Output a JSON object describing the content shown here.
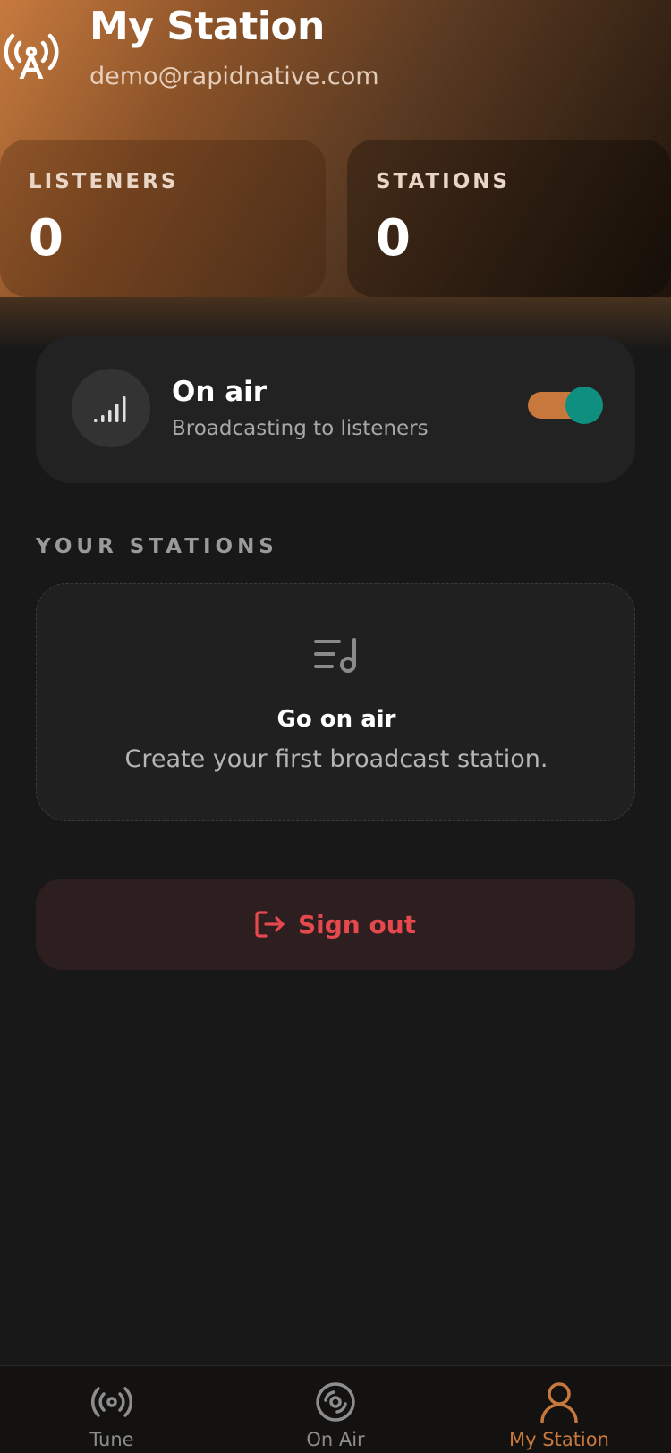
{
  "header": {
    "title": "My Station",
    "email": "demo@rapidnative.com"
  },
  "stats": [
    {
      "label": "LISTENERS",
      "value": "0"
    },
    {
      "label": "STATIONS",
      "value": "0"
    }
  ],
  "on_air": {
    "title": "On air",
    "subtitle": "Broadcasting to listeners",
    "enabled": true
  },
  "stations_section": {
    "label": "YOUR STATIONS",
    "empty_title": "Go on air",
    "empty_subtitle": "Create your first broadcast station."
  },
  "sign_out": {
    "label": "Sign out"
  },
  "nav": [
    {
      "label": "Tune",
      "icon": "broadcast-icon",
      "active": false
    },
    {
      "label": "On Air",
      "icon": "disc-icon",
      "active": false
    },
    {
      "label": "My Station",
      "icon": "user-icon",
      "active": true
    }
  ],
  "colors": {
    "accent": "#c8783c",
    "toggle_knob": "#0f8f80",
    "danger": "#e5484d",
    "background": "#181818"
  }
}
